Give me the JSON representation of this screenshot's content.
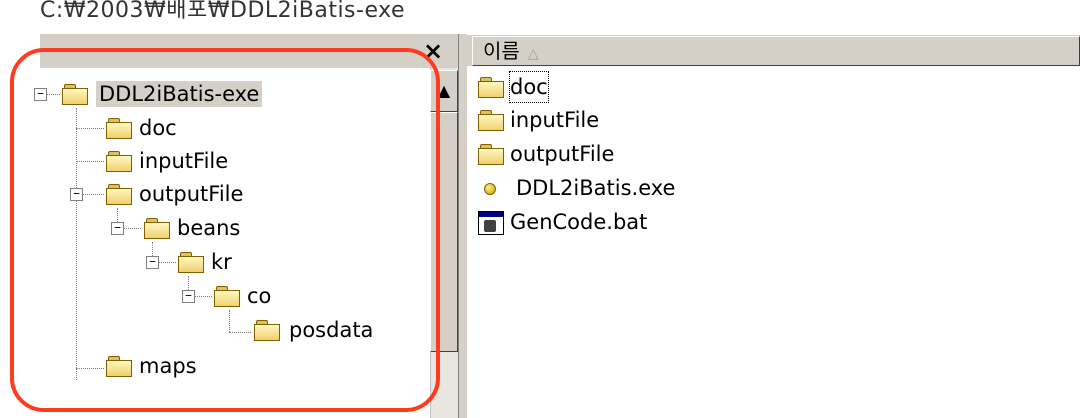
{
  "window": {
    "title": "C:₩2003₩배포₩DDL2iBatis-exe",
    "close_symbol": "×"
  },
  "tree": {
    "items": [
      {
        "label": "DDL2iBatis-exe",
        "expander": "−"
      },
      {
        "label": "doc"
      },
      {
        "label": "inputFile"
      },
      {
        "label": "outputFile",
        "expander": "−"
      },
      {
        "label": "beans",
        "expander": "−"
      },
      {
        "label": "kr",
        "expander": "−"
      },
      {
        "label": "co",
        "expander": "−"
      },
      {
        "label": "posdata"
      },
      {
        "label": "maps"
      }
    ],
    "scroll_up_symbol": "▲"
  },
  "list": {
    "column_header": "이름",
    "sort_indicator": "△",
    "items": [
      {
        "label": "doc",
        "icon": "folder-icon"
      },
      {
        "label": "inputFile",
        "icon": "folder-icon"
      },
      {
        "label": "outputFile",
        "icon": "folder-icon"
      },
      {
        "label": "DDL2iBatis.exe",
        "icon": "exe-icon"
      },
      {
        "label": "GenCode.bat",
        "icon": "batch-file-icon"
      }
    ]
  },
  "colors": {
    "highlight_ring": "#ff3b1f",
    "chrome": "#d4d0c8",
    "folder": "#f0d070"
  }
}
